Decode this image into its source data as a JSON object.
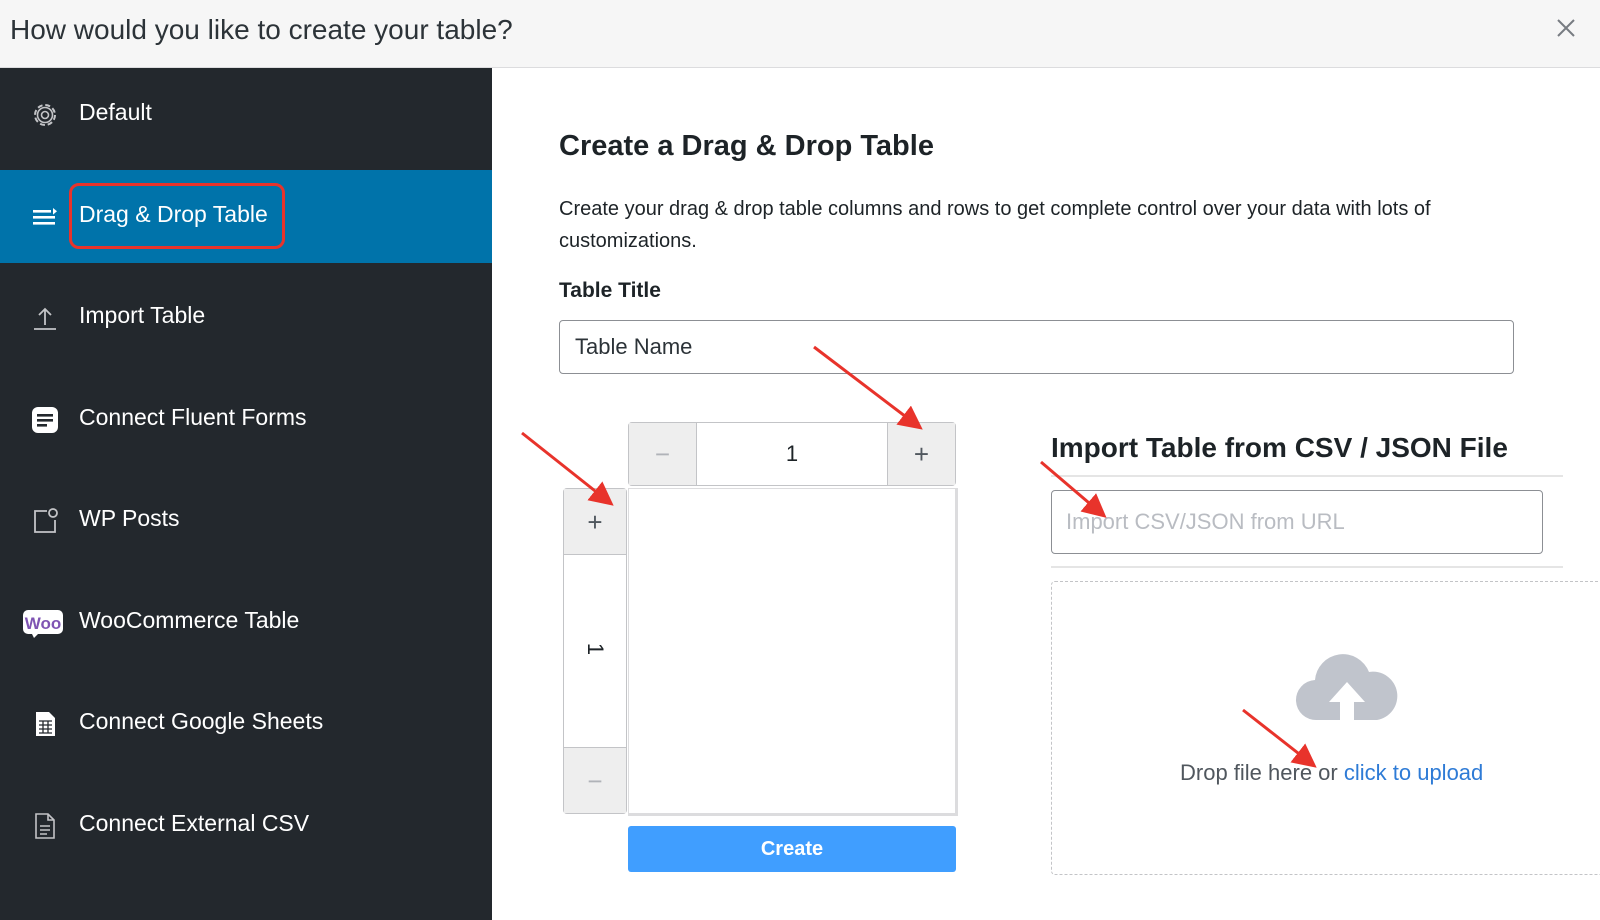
{
  "dialog": {
    "title": "How would you like to create your table?"
  },
  "sidebar": {
    "items": [
      {
        "label": "Default",
        "icon": "gear-icon"
      },
      {
        "label": "Drag & Drop Table",
        "icon": "list-icon",
        "active": true
      },
      {
        "label": "Import Table",
        "icon": "upload-icon"
      },
      {
        "label": "Connect Fluent Forms",
        "icon": "fluent-forms-icon"
      },
      {
        "label": "WP Posts",
        "icon": "post-icon"
      },
      {
        "label": "WooCommerce Table",
        "icon": "woo-logo-icon",
        "icon_text": "Woo"
      },
      {
        "label": "Connect Google Sheets",
        "icon": "spreadsheet-icon"
      },
      {
        "label": "Connect External CSV",
        "icon": "document-icon"
      }
    ],
    "active_color": "#0073aa",
    "background_color": "#23282d"
  },
  "main": {
    "heading": "Create a Drag & Drop Table",
    "description": "Create your drag & drop table columns and rows to get complete control over your data with lots of customizations.",
    "table_title_label": "Table Title",
    "table_title_value": "Table Name",
    "columns_stepper": {
      "minus": "−",
      "value": "1",
      "plus": "+"
    },
    "rows_stepper": {
      "plus": "+",
      "value": "1",
      "minus": "−"
    },
    "create_button": "Create",
    "create_button_color": "#409eff"
  },
  "import": {
    "heading": "Import Table from CSV / JSON File",
    "url_placeholder": "Import CSV/JSON from URL",
    "drop_text": "Drop file here or ",
    "upload_link": "click to upload",
    "link_color": "#2e7bd6"
  },
  "annotations": {
    "highlight_color": "#e8332b",
    "arrow_color": "#e8332b"
  }
}
